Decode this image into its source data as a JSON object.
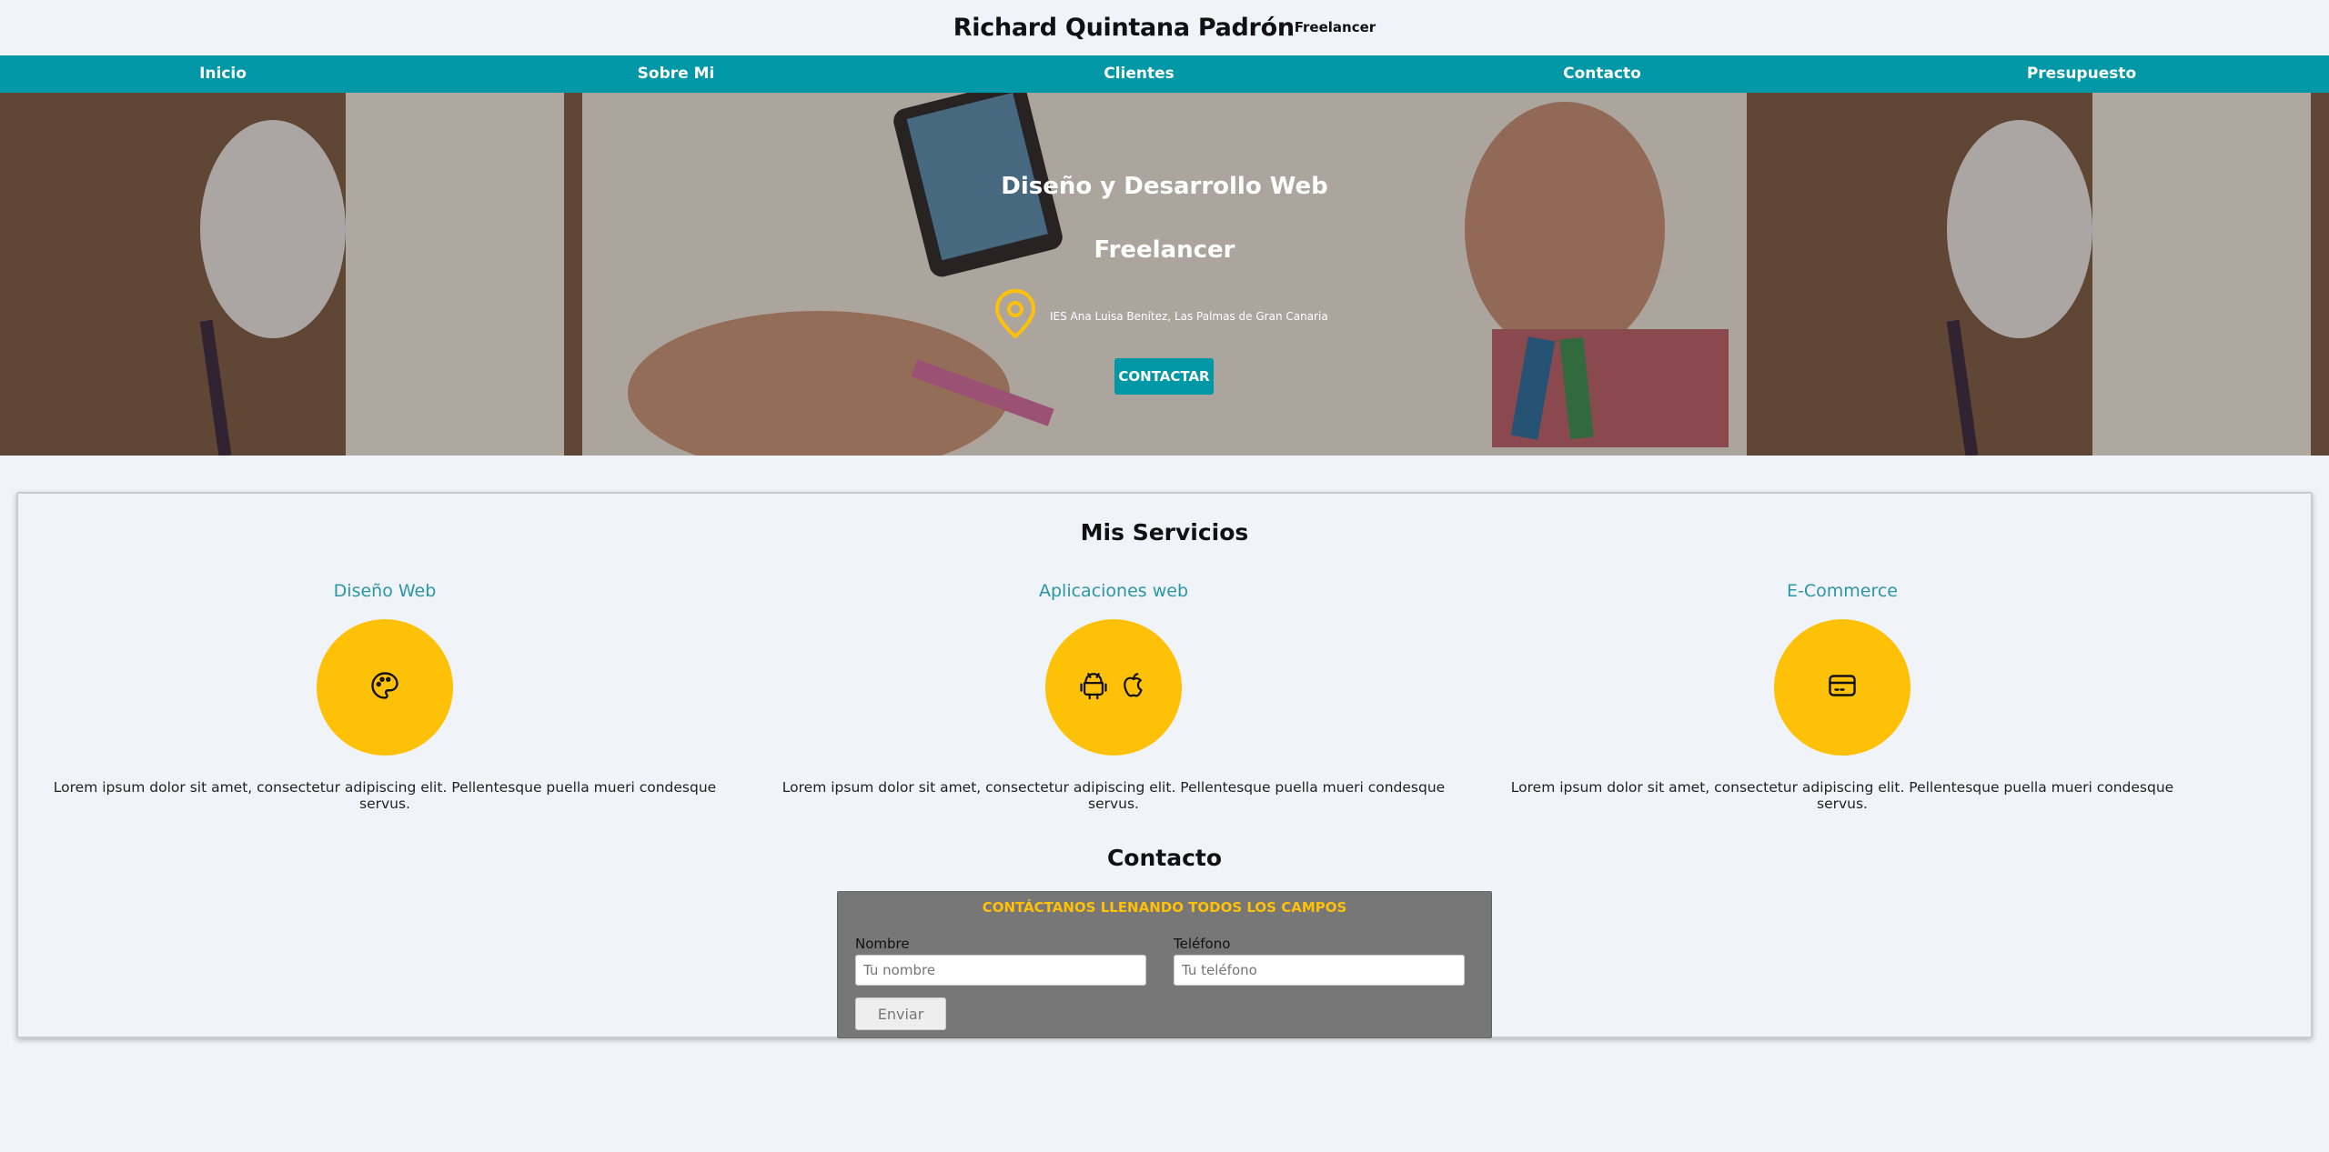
{
  "header": {
    "name": "Richard Quintana Padrón",
    "tagline": "Freelancer"
  },
  "nav": [
    "Inicio",
    "Sobre Mi",
    "Clientes",
    "Contacto",
    "Presupuesto"
  ],
  "hero": {
    "heading": "Diseño y Desarrollo Web",
    "subheading": "Freelancer",
    "location": "IES Ana Luisa Benítez, Las Palmas de Gran Canaria",
    "location_icon": "map-pin-icon",
    "button": "CONTACTAR"
  },
  "services": {
    "title": "Mis Servicios",
    "items": [
      {
        "title": "Diseño Web",
        "icon": "palette-icon",
        "desc": "Lorem ipsum dolor sit amet, consectetur adipiscing elit. Pellentesque puella mueri condesque servus."
      },
      {
        "title": "Aplicaciones web",
        "icon": "android-apple-icons",
        "desc": "Lorem ipsum dolor sit amet, consectetur adipiscing elit. Pellentesque puella mueri condesque servus."
      },
      {
        "title": "E-Commerce",
        "icon": "credit-card-icon",
        "desc": "Lorem ipsum dolor sit amet, consectetur adipiscing elit. Pellentesque puella mueri condesque servus."
      }
    ]
  },
  "contact": {
    "title": "Contacto",
    "form_heading": "CONTÁCTANOS LLENANDO TODOS LOS CAMPOS",
    "name_label": "Nombre",
    "name_placeholder": "Tu nombre",
    "phone_label": "Teléfono",
    "phone_placeholder": "Tu teléfono",
    "submit": "Enviar"
  },
  "colors": {
    "teal": "#0097a7",
    "yellow": "#ffc107",
    "background": "#f0f3f8",
    "form_bg": "#777777"
  }
}
